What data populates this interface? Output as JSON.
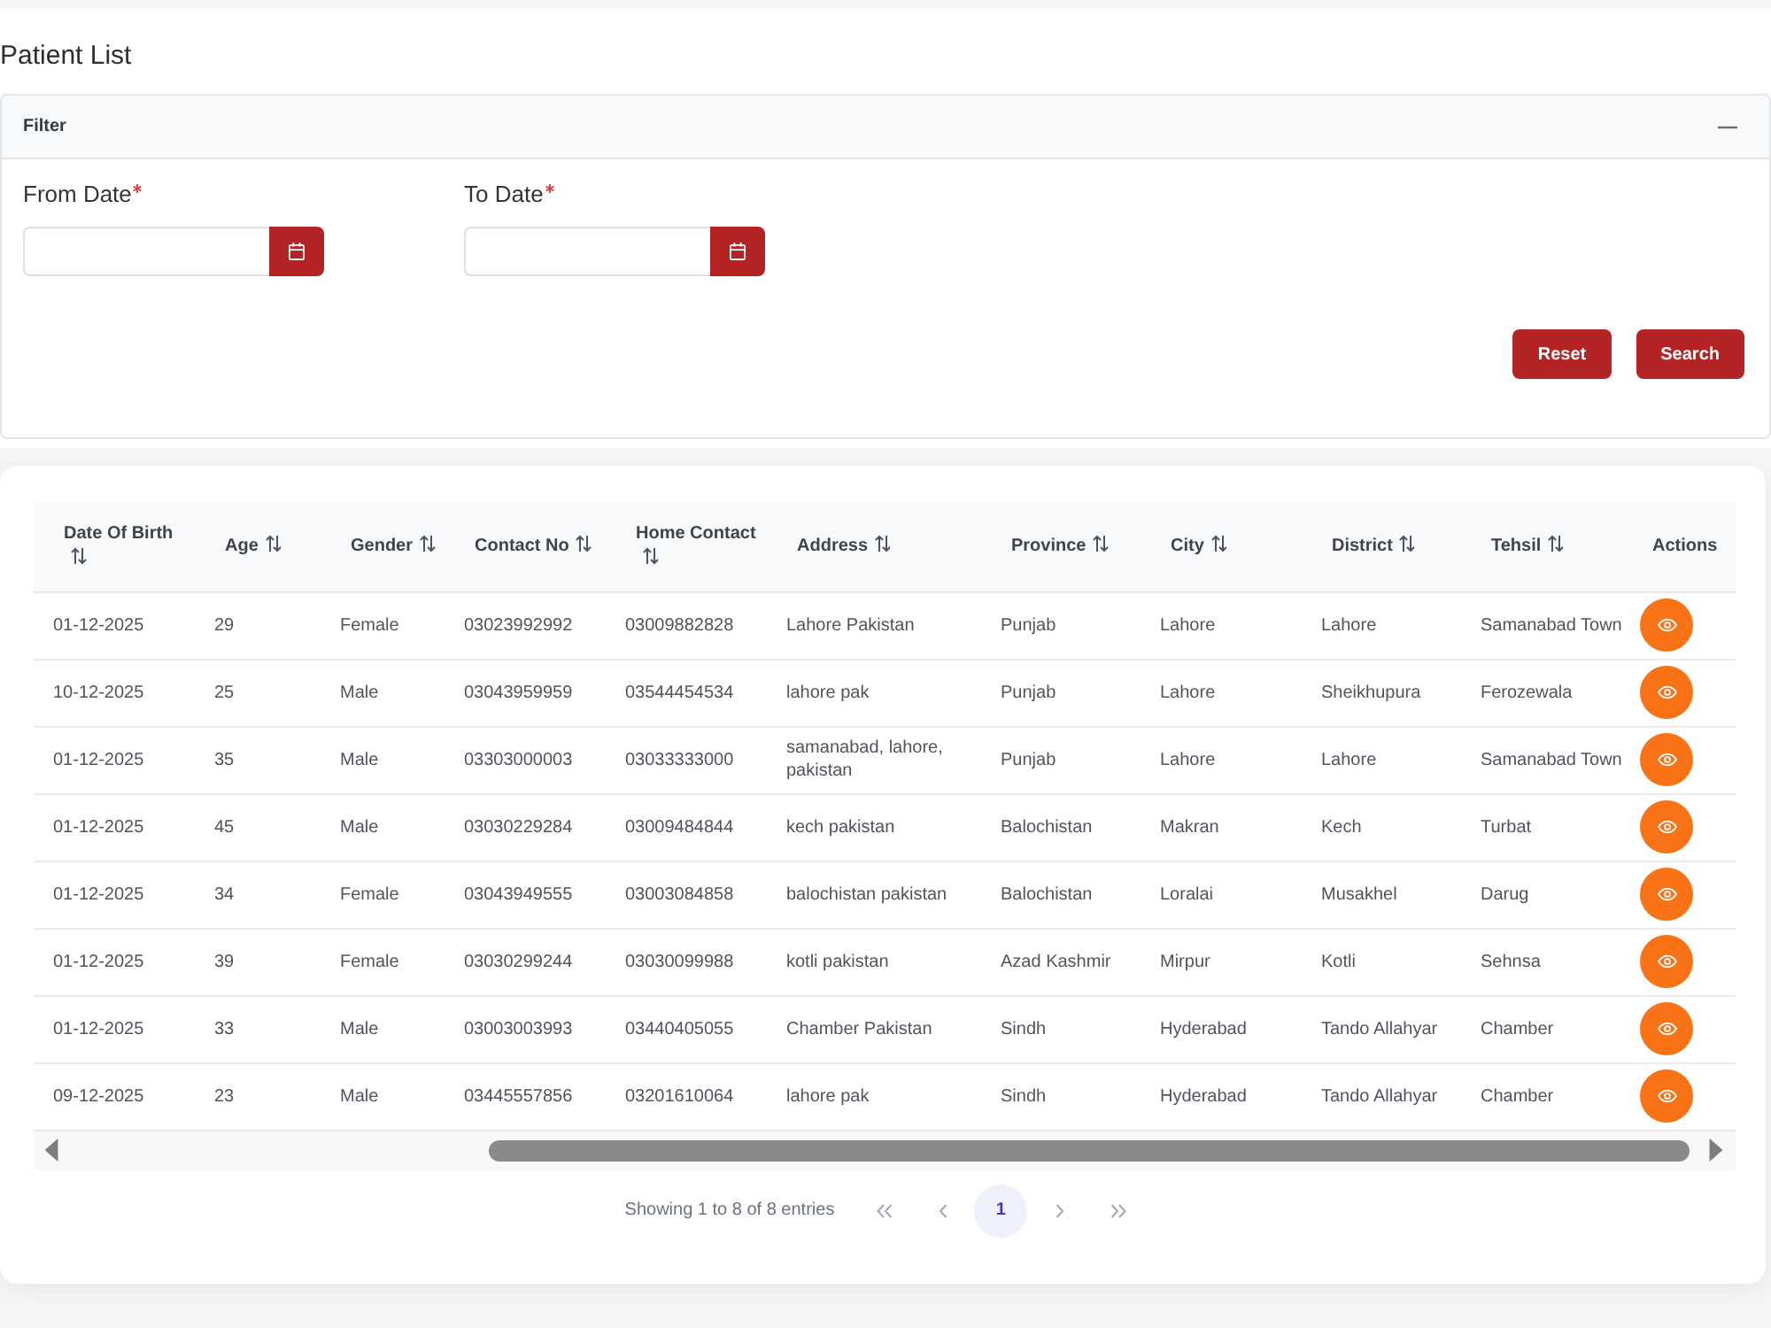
{
  "page": {
    "title": "Patient List"
  },
  "filter": {
    "title": "Filter",
    "expanded": true,
    "fields": [
      {
        "label": "From Date",
        "required": true
      },
      {
        "label": "To Date",
        "required": true
      }
    ],
    "buttons": [
      "Reset",
      "Search"
    ]
  },
  "table": {
    "columns": [
      {
        "label": "Date Of Birth",
        "sortable": true
      },
      {
        "label": "Age",
        "sortable": true
      },
      {
        "label": "Gender",
        "sortable": true
      },
      {
        "label": "Contact No",
        "sortable": true
      },
      {
        "label": "Home Contact",
        "sortable": true
      },
      {
        "label": "Address",
        "sortable": true
      },
      {
        "label": "Province",
        "sortable": true
      },
      {
        "label": "City",
        "sortable": true
      },
      {
        "label": "District",
        "sortable": true
      },
      {
        "label": "Tehsil",
        "sortable": true
      },
      {
        "label": "Actions",
        "sortable": false
      }
    ],
    "rows": [
      [
        "01-12-2025",
        "29",
        "Female",
        "03023992992",
        "03009882828",
        "Lahore Pakistan",
        "Punjab",
        "Lahore",
        "Lahore",
        "Samanabad Town"
      ],
      [
        "10-12-2025",
        "25",
        "Male",
        "03043959959",
        "03544454534",
        "lahore pak",
        "Punjab",
        "Lahore",
        "Sheikhupura",
        "Ferozewala"
      ],
      [
        "01-12-2025",
        "35",
        "Male",
        "03303000003",
        "03033333000",
        "samanabad, lahore, pakistan",
        "Punjab",
        "Lahore",
        "Lahore",
        "Samanabad Town"
      ],
      [
        "01-12-2025",
        "45",
        "Male",
        "03030229284",
        "03009484844",
        "kech pakistan",
        "Balochistan",
        "Makran",
        "Kech",
        "Turbat"
      ],
      [
        "01-12-2025",
        "34",
        "Female",
        "03043949555",
        "03003084858",
        "balochistan pakistan",
        "Balochistan",
        "Loralai",
        "Musakhel",
        "Darug"
      ],
      [
        "01-12-2025",
        "39",
        "Female",
        "03030299244",
        "03030099988",
        "kotli pakistan",
        "Azad Kashmir",
        "Mirpur",
        "Kotli",
        "Sehnsa"
      ],
      [
        "01-12-2025",
        "33",
        "Male",
        "03003003993",
        "03440405055",
        "Chamber Pakistan",
        "Sindh",
        "Hyderabad",
        "Tando Allahyar",
        "Chamber"
      ],
      [
        "09-12-2025",
        "23",
        "Male",
        "03445557856",
        "03201610064",
        "lahore pak",
        "Sindh",
        "Hyderabad",
        "Tando Allahyar",
        "Chamber"
      ]
    ]
  },
  "pagination": {
    "summary": "Showing 1 to 8 of 8 entries",
    "pages": [
      {
        "label": "1",
        "selected": true
      }
    ]
  }
}
